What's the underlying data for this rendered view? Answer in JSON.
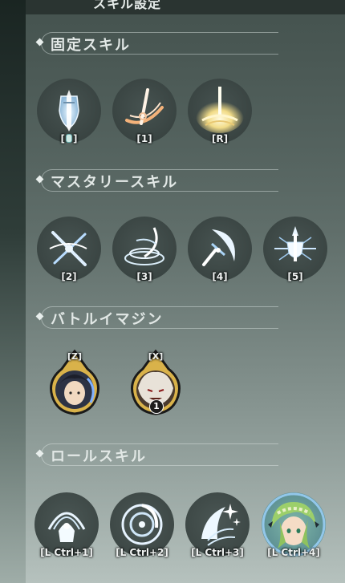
{
  "header": {
    "title": "スキル設定"
  },
  "sections": {
    "fixed": {
      "title": "固定スキル"
    },
    "mastery": {
      "title": "マスタリースキル"
    },
    "imagine": {
      "title": "バトルイマジン"
    },
    "role": {
      "title": "ロールスキル"
    }
  },
  "fixed_skills": [
    {
      "icon": "shield-sword-icon",
      "key": "[",
      "key_suffix": "]",
      "key_glyph": "mouse-left-icon"
    },
    {
      "icon": "slash-icon",
      "key": "[1]"
    },
    {
      "icon": "light-burst-icon",
      "key": "[R]"
    }
  ],
  "mastery_skills": [
    {
      "icon": "cross-slash-icon",
      "key": "[2]"
    },
    {
      "icon": "whirlwind-icon",
      "key": "[3]"
    },
    {
      "icon": "crescent-strike-icon",
      "key": "[4]"
    },
    {
      "icon": "sword-shield-burst-icon",
      "key": "[5]"
    }
  ],
  "imagine_skills": [
    {
      "icon": "imagine-portrait-dark-hair-icon",
      "key": "[Z]"
    },
    {
      "icon": "imagine-portrait-white-beast-icon",
      "key": "[X]",
      "badge": "1"
    }
  ],
  "role_skills": [
    {
      "icon": "aura-hand-icon",
      "key": "[L Ctrl+1]"
    },
    {
      "icon": "ring-swirl-icon",
      "key": "[L Ctrl+2]"
    },
    {
      "icon": "sparkle-wing-icon",
      "key": "[L Ctrl+3]"
    },
    {
      "icon": "portrait-green-hair-icon",
      "key": "[L Ctrl+4]"
    }
  ],
  "colors": {
    "accent_gold": "#d9b24a",
    "glow_blue": "#9fd4ff",
    "key_text": "#f0f3f2"
  }
}
